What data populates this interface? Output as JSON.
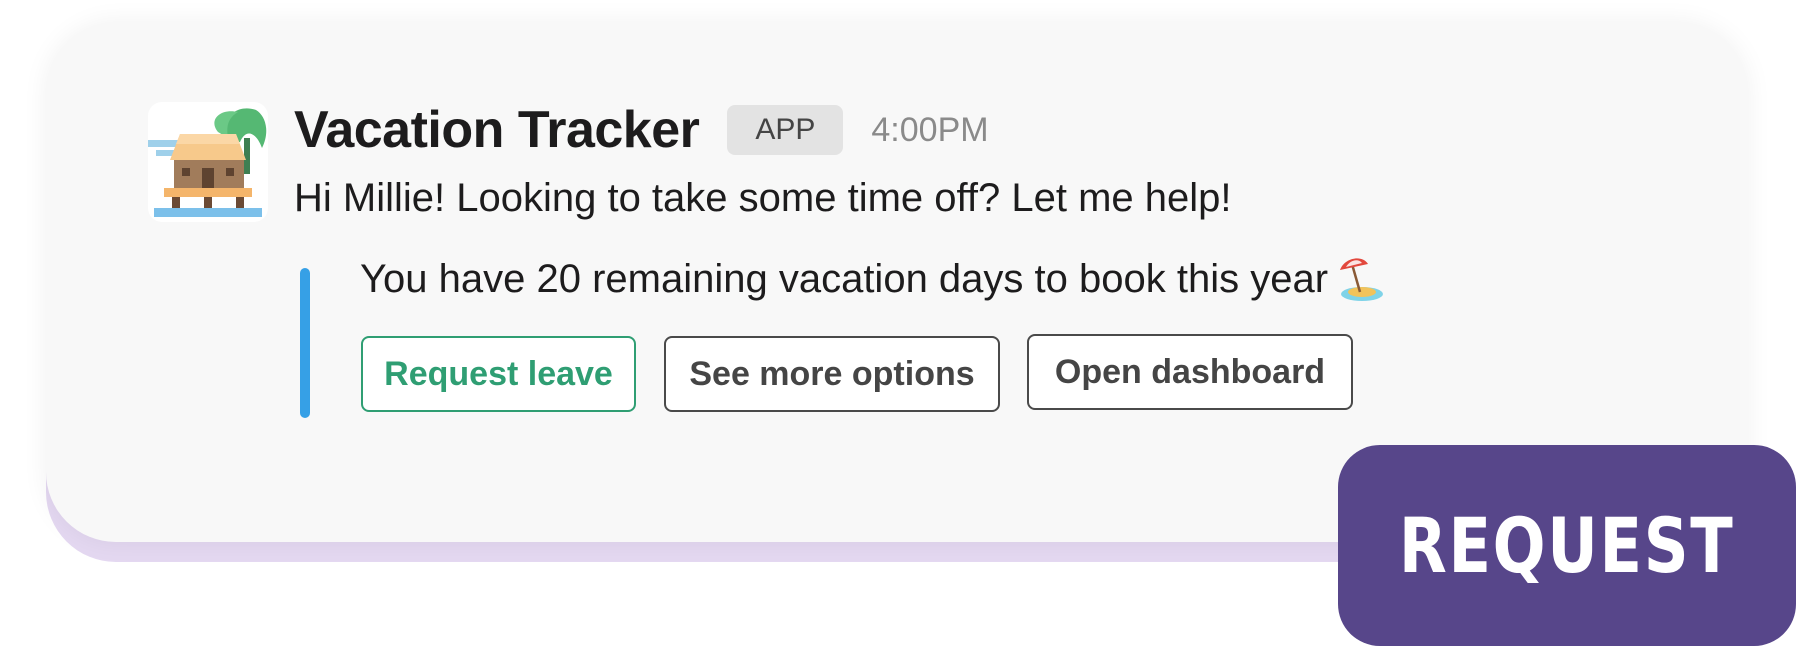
{
  "message": {
    "sender": "Vacation Tracker",
    "badge": "APP",
    "time": "4:00PM",
    "text": "Hi Millie! Looking to take some time off? Let me help!"
  },
  "attachment": {
    "text": "You have 20 remaining vacation days to book this year",
    "emoji_icon": "beach-umbrella-icon",
    "accent_color": "#36a0e6"
  },
  "buttons": {
    "request_leave": "Request leave",
    "see_more": "See more options",
    "open_dashboard": "Open dashboard"
  },
  "overlay": {
    "label": "REQUEST",
    "color": "#57468a"
  },
  "colors": {
    "primary_button": "#2f9e73",
    "card_background": "#f8f8f8",
    "card_edge": "#e4d8f1"
  }
}
